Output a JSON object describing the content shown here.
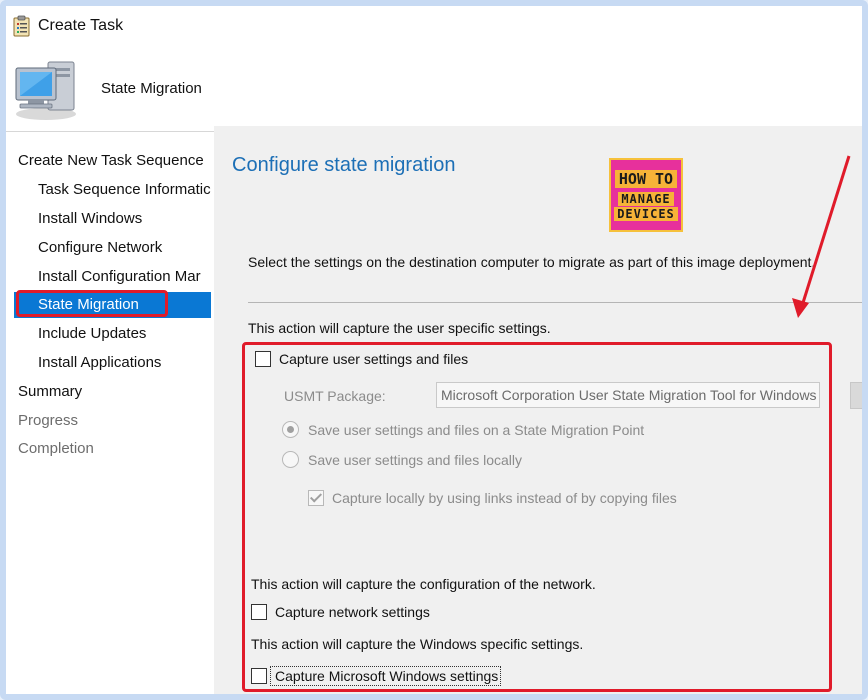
{
  "window": {
    "title": "Create Task"
  },
  "header": {
    "title": "State Migration"
  },
  "sidebar": {
    "items": [
      {
        "label": "Create New Task Sequence",
        "level": "top",
        "state": "normal"
      },
      {
        "label": "Task Sequence Informatic",
        "level": "sub",
        "state": "normal"
      },
      {
        "label": "Install Windows",
        "level": "sub",
        "state": "normal"
      },
      {
        "label": "Configure Network",
        "level": "sub",
        "state": "normal"
      },
      {
        "label": "Install Configuration Mar",
        "level": "sub",
        "state": "normal"
      },
      {
        "label": "State Migration",
        "level": "sub",
        "state": "selected"
      },
      {
        "label": "Include Updates",
        "level": "sub",
        "state": "normal"
      },
      {
        "label": "Install Applications",
        "level": "sub",
        "state": "normal"
      },
      {
        "label": "Summary",
        "level": "top",
        "state": "normal"
      },
      {
        "label": "Progress",
        "level": "top",
        "state": "disabled"
      },
      {
        "label": "Completion",
        "level": "top",
        "state": "disabled"
      }
    ]
  },
  "main": {
    "title": "Configure state migration",
    "logo": {
      "line1": "HOW TO",
      "line2": "MANAGE",
      "line3": "DEVICES"
    },
    "description": "Select the settings on the destination computer to migrate as part of this image deployment.",
    "user_section": {
      "caption": "This action will capture the user specific settings.",
      "capture_user_label": "Capture user settings and files",
      "capture_user_checked": false,
      "usmt_label": "USMT Package:",
      "usmt_value": "Microsoft Corporation User State Migration Tool for Windows",
      "radio_smp_label": "Save user settings and files on a State Migration Point",
      "radio_smp_selected": true,
      "radio_local_label": "Save user settings and files locally",
      "radio_local_selected": false,
      "capture_links_label": "Capture locally by using links instead of by copying files",
      "capture_links_checked": true
    },
    "network_section": {
      "caption": "This action will capture the configuration of the network.",
      "capture_network_label": "Capture network settings",
      "capture_network_checked": false
    },
    "windows_section": {
      "caption": "This action will capture the Windows specific settings.",
      "capture_windows_label": "Capture Microsoft Windows settings",
      "capture_windows_checked": false
    }
  },
  "colors": {
    "accent": "#0a78d4",
    "title_blue": "#1c6fb6",
    "annotation_red": "#e01b2a",
    "frame_blue": "#c7daf3",
    "logo_pink": "#e7309c",
    "logo_yellow": "#f6b338"
  }
}
